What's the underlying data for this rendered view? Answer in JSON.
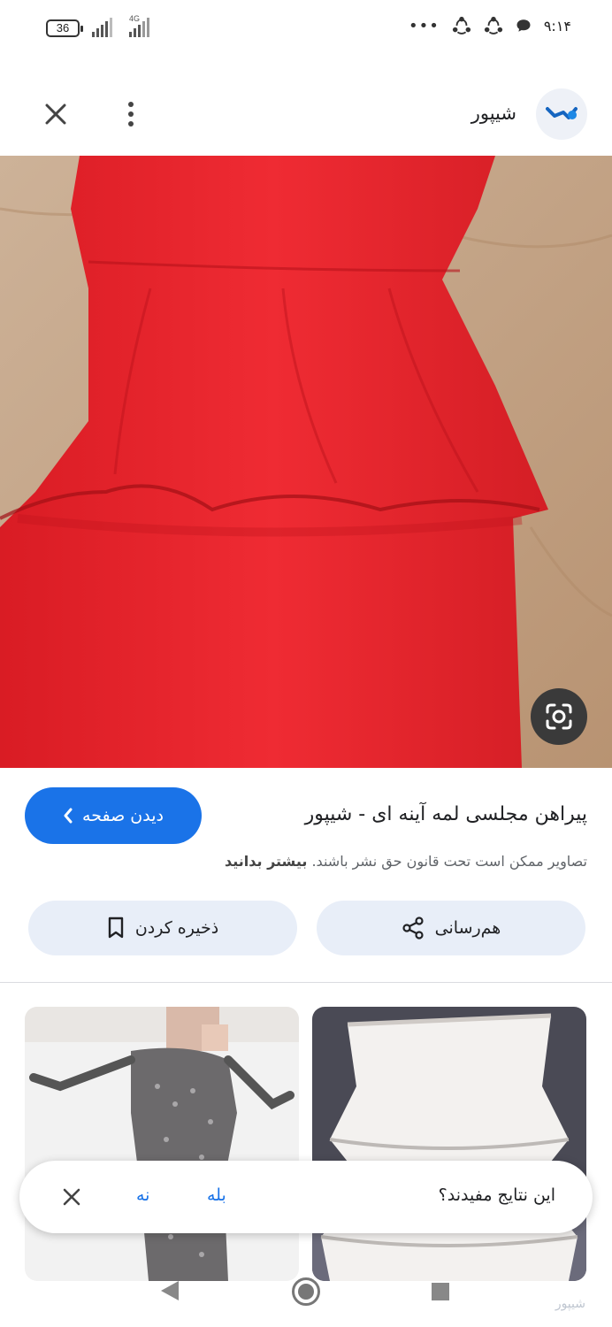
{
  "status_bar": {
    "battery_level": "36",
    "network_type": "4G",
    "overflow_dots": "•••",
    "time": "۹:۱۴",
    "icons": [
      "battery-icon",
      "signal-icon",
      "signal-4g-icon",
      "app-notification-icon",
      "app-notification-icon",
      "chat-bubble-icon"
    ]
  },
  "header": {
    "site_name": "شیپور",
    "icons": {
      "close": "close-icon",
      "more": "more-vertical-icon",
      "logo": "sheypoor-logo-icon"
    }
  },
  "main_image": {
    "description_icon": "google-lens-icon",
    "colors": {
      "dress": "#e8242c",
      "background": "#c9a88a"
    }
  },
  "result": {
    "title": "پیراهن مجلسی لمه آینه ای - شیپور",
    "visit_button": "دیدن صفحه",
    "copyright_text": "تصاویر ممکن است تحت قانون حق نشر باشند.",
    "learn_more": "بیشتر بدانید"
  },
  "actions": {
    "share_label": "هم‌رسانی",
    "save_label": "ذخیره کردن",
    "share_icon": "share-icon",
    "save_icon": "bookmark-icon"
  },
  "feedback": {
    "question": "این نتایج مفیدند؟",
    "yes": "بله",
    "no": "نه",
    "close_icon": "close-icon"
  },
  "nav": {
    "back_icon": "nav-back-icon",
    "home_icon": "nav-home-icon",
    "recent_icon": "nav-recent-icon",
    "watermark": "شیپور"
  },
  "colors": {
    "accent": "#1a73e8",
    "chip_bg": "#e8eef8",
    "text": "#202124",
    "muted": "#5f6368"
  }
}
